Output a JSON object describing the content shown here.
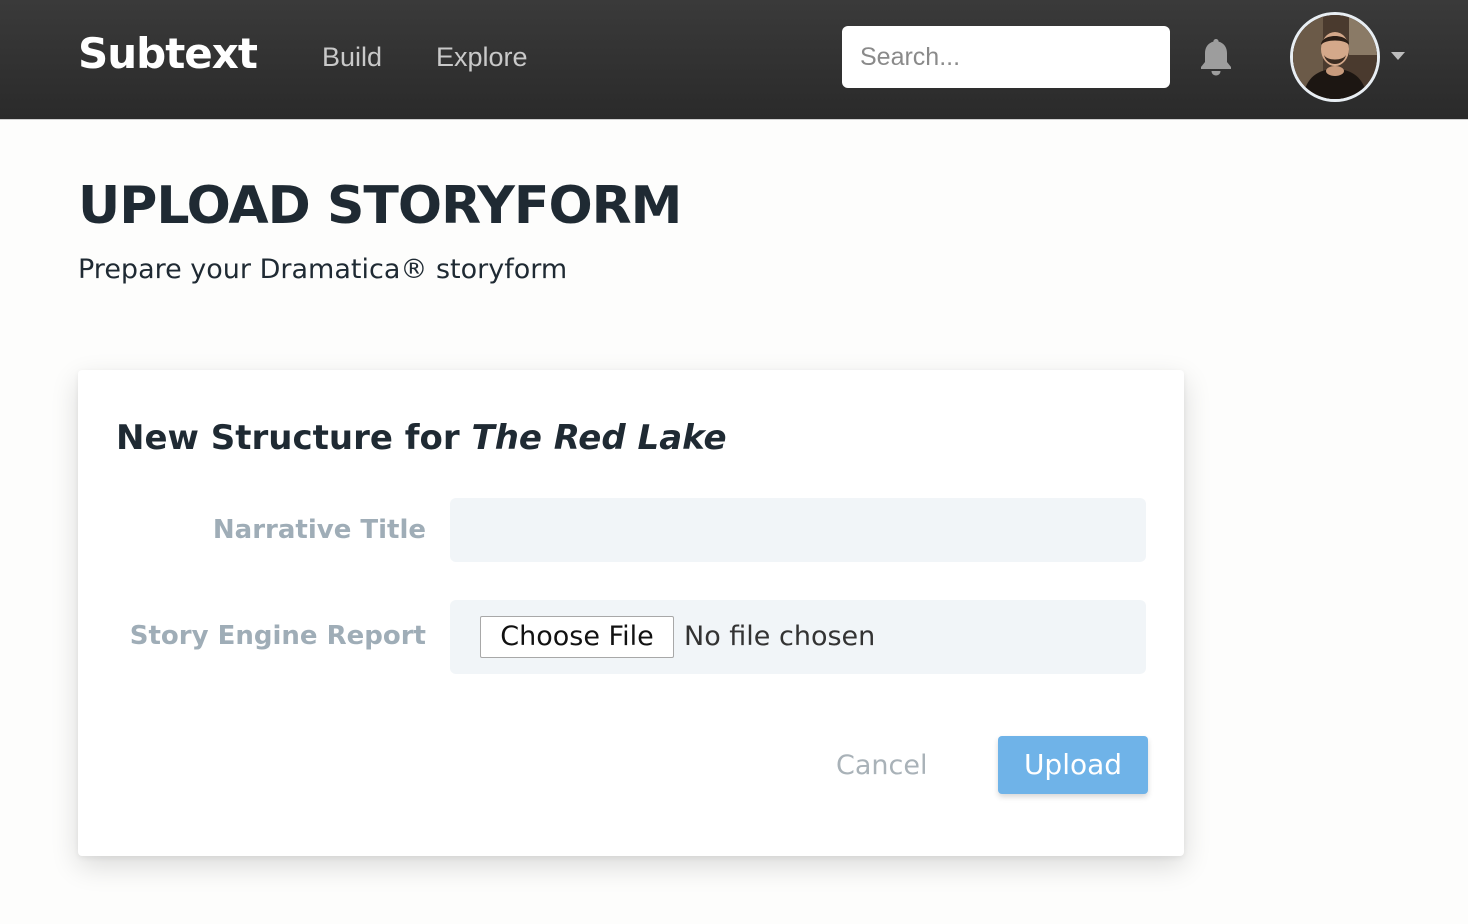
{
  "navbar": {
    "brand": "Subtext",
    "links": [
      {
        "label": "Build"
      },
      {
        "label": "Explore"
      }
    ],
    "search": {
      "placeholder": "Search...",
      "value": ""
    },
    "icons": {
      "notifications": "bell-icon",
      "menu": "chevron-down-icon"
    }
  },
  "page": {
    "title": "UPLOAD STORYFORM",
    "subtitle": "Prepare your Dramatica® storyform"
  },
  "form": {
    "heading_prefix": "New Structure for",
    "heading_story": "The Red Lake",
    "fields": {
      "narrative_title": {
        "label": "Narrative Title",
        "value": ""
      },
      "story_engine_report": {
        "label": "Story Engine Report",
        "button_label": "Choose File",
        "status": "No file chosen"
      }
    },
    "actions": {
      "cancel_label": "Cancel",
      "upload_label": "Upload"
    }
  },
  "colors": {
    "navbar_bg": "#2f2f2f",
    "upload_button": "#6fb3e8",
    "field_bg": "#f1f5f8",
    "label_text": "#9fadb7",
    "heading_text": "#1f2a33"
  }
}
